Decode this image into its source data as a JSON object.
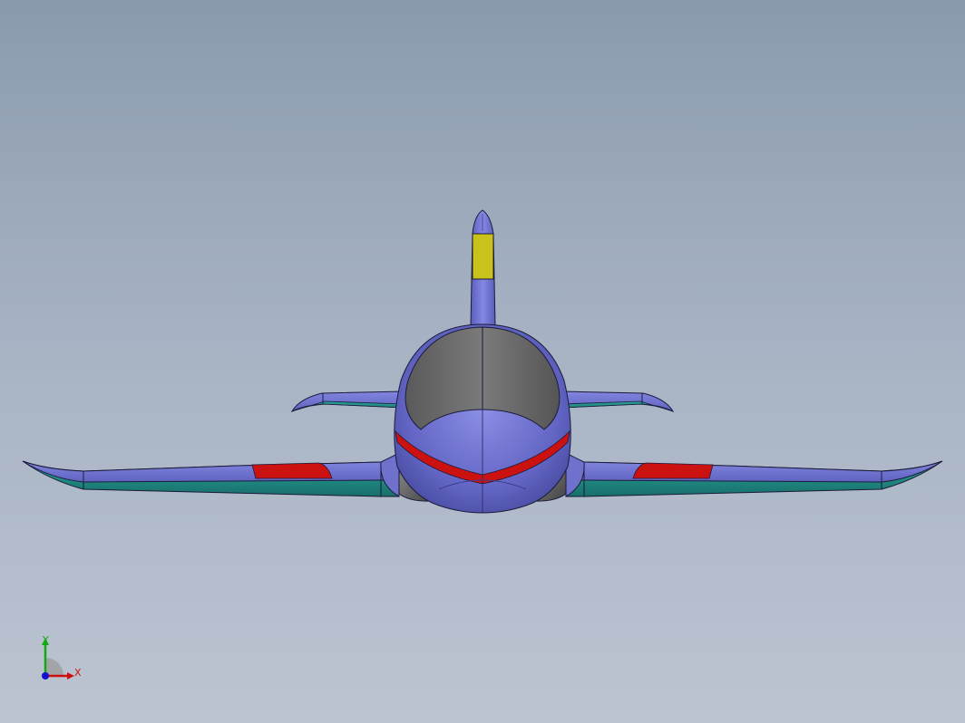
{
  "triad": {
    "x_label": "X",
    "y_label": "Y",
    "x_color": "#cc1111",
    "y_color": "#11aa11",
    "z_color": "#1111cc"
  },
  "colors": {
    "body": "#6f72cc",
    "wing_underside": "#1f8f88",
    "canopy": "#6b6b6b",
    "stripe": "#cc1111",
    "tail_band": "#c8c21a",
    "background_top": "#8a9aad",
    "background_bottom": "#bcc4d1"
  }
}
